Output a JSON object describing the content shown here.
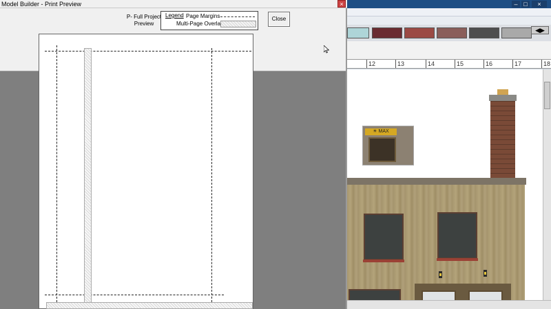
{
  "background_app": {
    "window_controls": [
      "–",
      "□",
      "×"
    ],
    "swatches": [
      "#aed5d8",
      "#6a2b31",
      "#9b4a44",
      "#8a5e5a",
      "#4e4e4e",
      "#a9a9a9"
    ],
    "swatch_nav": "◀▶",
    "ruler": [
      "12",
      "13",
      "14",
      "15",
      "16",
      "17",
      "18"
    ],
    "shop_sign": "☀ MAX"
  },
  "preview": {
    "title": "Model Builder - Print Preview",
    "close_x": "×",
    "project_label": "P- Full Project\nPreview",
    "legend": {
      "title": "Legend",
      "page_margins": "Page Margins",
      "overlap": "Multi-Page Overlap"
    },
    "close_button": "Close"
  }
}
